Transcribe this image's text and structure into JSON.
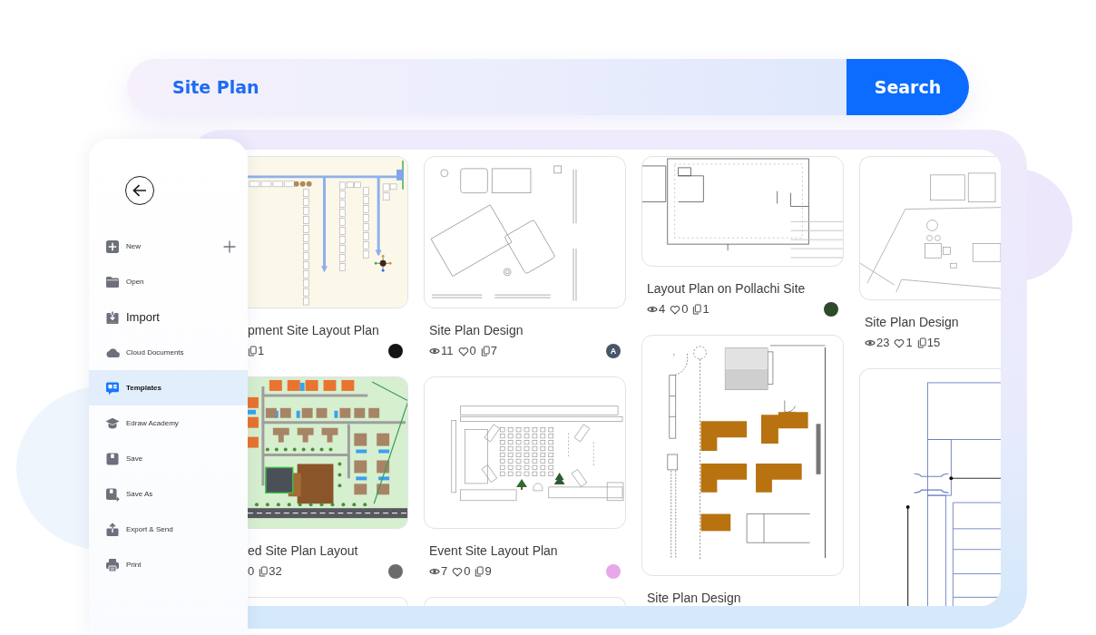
{
  "search": {
    "value": "Site Plan",
    "button": "Search"
  },
  "sidebar": {
    "items": [
      {
        "label": "New",
        "kind": "add",
        "selected": false
      },
      {
        "label": "Open",
        "kind": "item",
        "selected": false
      },
      {
        "label": "Import",
        "kind": "large",
        "selected": false
      },
      {
        "label": "Cloud Documents",
        "kind": "item",
        "selected": false
      },
      {
        "label": "Templates",
        "kind": "item",
        "selected": true
      },
      {
        "label": "Edraw Academy",
        "kind": "item",
        "selected": false
      },
      {
        "label": "Save",
        "kind": "item",
        "selected": false
      },
      {
        "label": "Save As",
        "kind": "item",
        "selected": false
      },
      {
        "label": "Export & Send",
        "kind": "item",
        "selected": false
      },
      {
        "label": "Print",
        "kind": "item",
        "selected": false
      }
    ]
  },
  "templates": {
    "columns": [
      {
        "cards": [
          {
            "title": "pment Site Layout Plan",
            "cut": false,
            "stats": [
              {
                "kind": "copies",
                "value": "1"
              }
            ],
            "avatar": {
              "kind": "photo",
              "color": "#141414"
            }
          },
          {
            "title": "ed Site Plan Layout",
            "cut": false,
            "stats": [
              {
                "kind": "plain",
                "value": "0"
              },
              {
                "kind": "copies",
                "value": "32"
              }
            ],
            "avatar": {
              "kind": "photo",
              "color": "#6b6b6b"
            }
          },
          {
            "cut": true
          }
        ]
      },
      {
        "cards": [
          {
            "title": "Site Plan Design",
            "cut": false,
            "stats": [
              {
                "kind": "views",
                "value": "11"
              },
              {
                "kind": "likes",
                "value": "0"
              },
              {
                "kind": "copies",
                "value": "7"
              }
            ],
            "avatar": {
              "kind": "letter",
              "text": "A",
              "color": "#475569"
            }
          },
          {
            "title": "Event Site Layout Plan",
            "cut": false,
            "stats": [
              {
                "kind": "views",
                "value": "7"
              },
              {
                "kind": "likes",
                "value": "0"
              },
              {
                "kind": "copies",
                "value": "9"
              }
            ],
            "avatar": {
              "kind": "photo",
              "color": "#e6a8e8"
            }
          },
          {
            "cut": true
          }
        ]
      },
      {
        "cards": [
          {
            "title": "Layout Plan on Pollachi Site",
            "cut": false,
            "stats": [
              {
                "kind": "views",
                "value": "4"
              },
              {
                "kind": "likes",
                "value": "0"
              },
              {
                "kind": "copies",
                "value": "1"
              }
            ],
            "avatar": {
              "kind": "photo",
              "color": "#2d4a2b"
            }
          },
          {
            "title": "Site Plan Design",
            "cut": false
          }
        ]
      },
      {
        "cards": [
          {
            "title": "Site Plan Design",
            "cut": false,
            "stats": [
              {
                "kind": "views",
                "value": "23"
              },
              {
                "kind": "likes",
                "value": "1"
              },
              {
                "kind": "copies",
                "value": "15"
              }
            ]
          },
          {
            "cut": true
          }
        ]
      }
    ]
  }
}
